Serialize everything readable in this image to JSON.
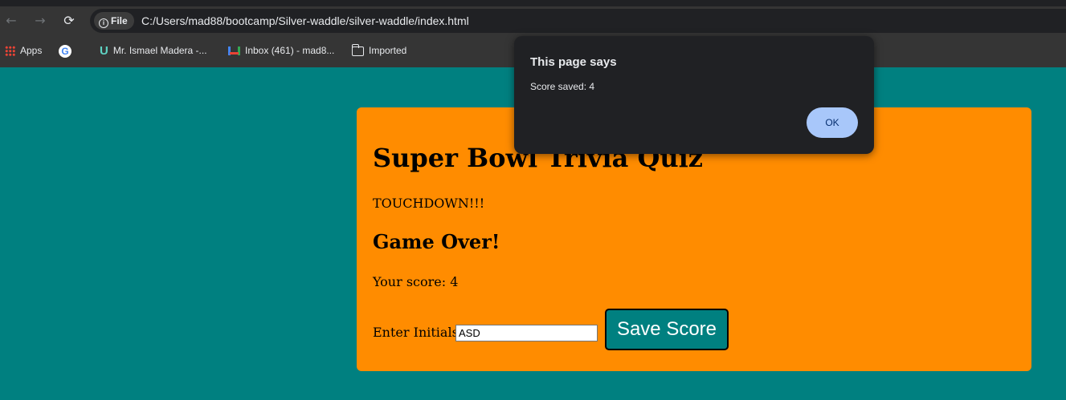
{
  "browser": {
    "nav": {
      "back": "←",
      "forward": "→",
      "reload": "⟳"
    },
    "site_chip": "File",
    "url": "C:/Users/mad88/bootcamp/Silver-waddle/silver-waddle/index.html",
    "bookmarks": [
      {
        "label": "Apps",
        "icon": "apps-grid-icon"
      },
      {
        "label": "",
        "icon": "google-icon"
      },
      {
        "label": "Mr. Ismael Madera -...",
        "icon": "u-logo-icon"
      },
      {
        "label": "Inbox (461) - mad8...",
        "icon": "gmail-icon"
      },
      {
        "label": "Imported",
        "icon": "folder-icon"
      }
    ]
  },
  "quiz": {
    "title": "Super Bowl Trivia Quiz",
    "feedback": "TOUCHDOWN!!!",
    "game_over": "Game Over!",
    "score_text": "Your score: 4",
    "initials_label": "Enter Initials:",
    "initials_value": "ASD",
    "save_button": "Save Score"
  },
  "dialog": {
    "title": "This page says",
    "message": "Score saved: 4",
    "ok_button": "OK"
  },
  "colors": {
    "page_background": "#008080",
    "card_background": "#ff8c00",
    "button_background": "#008080",
    "dialog_background": "#202124",
    "dialog_ok": "#a8c7fa"
  }
}
